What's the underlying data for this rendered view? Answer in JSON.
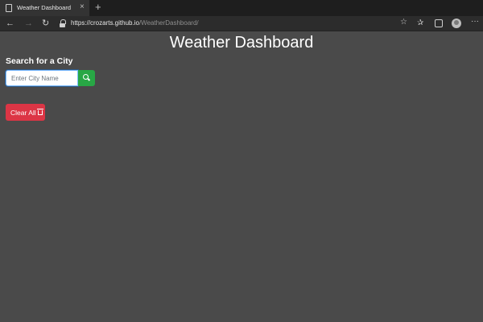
{
  "browser": {
    "tab_title": "Weather Dashboard",
    "tab_close": "×",
    "new_tab": "+",
    "url_host": "https://crozarts.github.io",
    "url_path": "/WeatherDashboard/",
    "icons": {
      "back": "arrow-left-icon",
      "forward": "arrow-right-icon",
      "refresh": "refresh-icon",
      "lock": "lock-icon",
      "star": "star-icon",
      "favorites": "favorites-icon",
      "collections": "collections-icon",
      "profile": "profile-avatar",
      "more": "more-icon"
    }
  },
  "page": {
    "title": "Weather Dashboard",
    "search_label": "Search for a City",
    "search_placeholder": "Enter City Name",
    "search_value": "",
    "clear_label": "Clear All"
  },
  "colors": {
    "background": "#4a4a4a",
    "search_button": "#28a745",
    "clear_button": "#dc3545",
    "input_focus": "#80bdff"
  }
}
